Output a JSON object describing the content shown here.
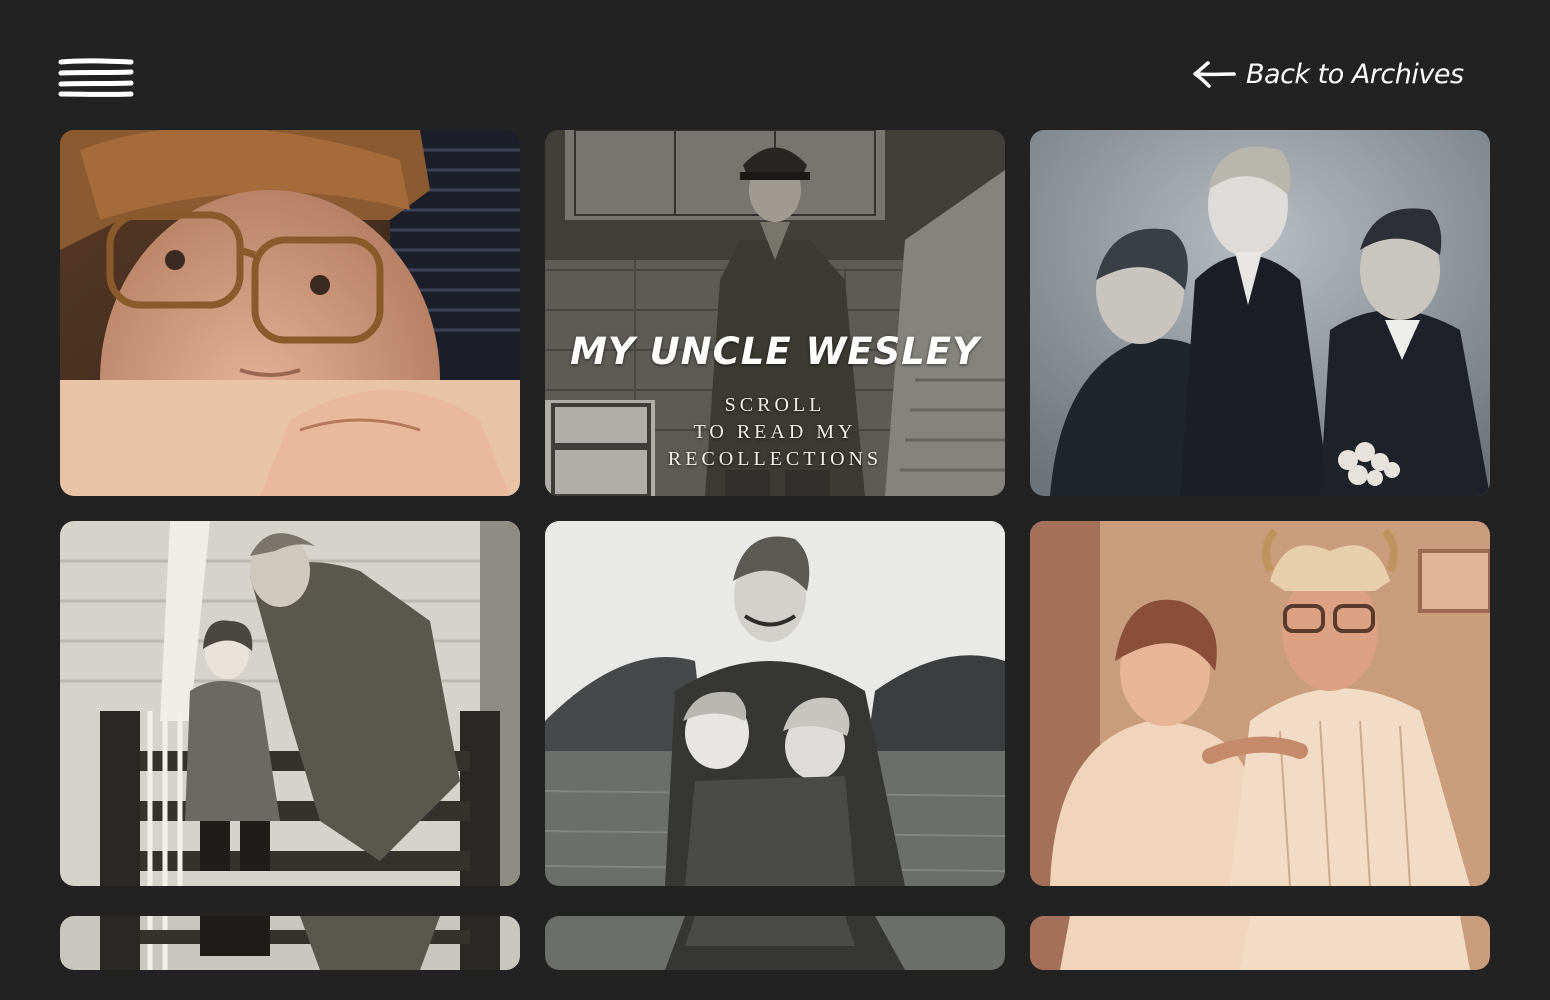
{
  "header": {
    "menu_icon": "hamburger-menu-icon",
    "back_icon": "arrow-left-icon",
    "back_label": "Back to Archives"
  },
  "story": {
    "title": "MY UNCLE WESLEY",
    "scroll_hint_lines": [
      "SCROLL",
      "TO READ MY",
      "RECOLLECTIONS"
    ]
  },
  "colors": {
    "background": "#222223",
    "text": "#ffffff"
  }
}
